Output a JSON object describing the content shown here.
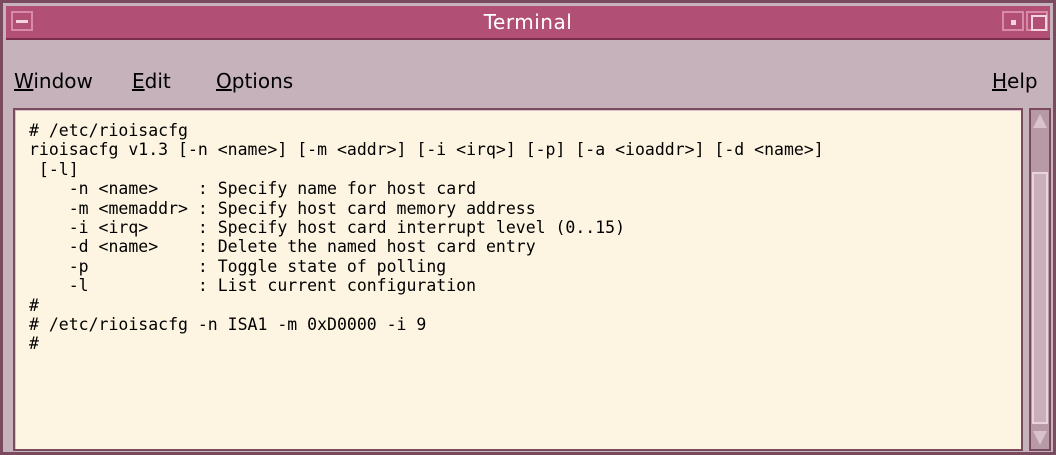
{
  "window": {
    "title": "Terminal",
    "menu": [
      {
        "mnemonic": "W",
        "rest": "indow"
      },
      {
        "mnemonic": "E",
        "rest": "dit"
      },
      {
        "mnemonic": "O",
        "rest": "ptions"
      },
      {
        "mnemonic": "H",
        "rest": "elp"
      }
    ]
  },
  "terminal": {
    "lines": [
      "# /etc/rioisacfg",
      "rioisacfg v1.3 [-n <name>] [-m <addr>] [-i <irq>] [-p] [-a <ioaddr>] [-d <name>]",
      " [-l]",
      "    -n <name>    : Specify name for host card",
      "    -m <memaddr> : Specify host card memory address",
      "    -i <irq>     : Specify host card interrupt level (0..15)",
      "    -d <name>    : Delete the named host card entry",
      "    -p           : Toggle state of polling",
      "    -l           : List current configuration",
      "#",
      "# /etc/rioisacfg -n ISA1 -m 0xD0000 -i 9",
      "#"
    ]
  }
}
